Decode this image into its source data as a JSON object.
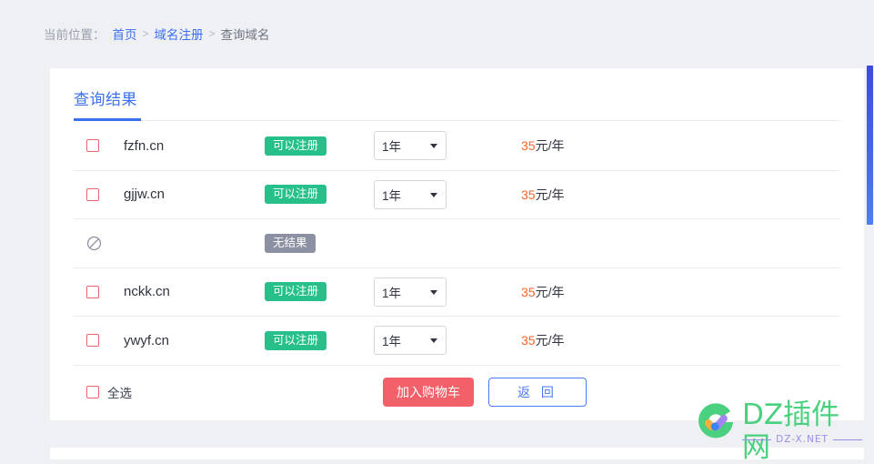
{
  "breadcrumb": {
    "label": "当前位置：",
    "items": [
      {
        "text": "首页",
        "type": "link"
      },
      {
        "text": "域名注册",
        "type": "link"
      },
      {
        "text": "查询域名",
        "type": "current"
      }
    ],
    "separator": ">"
  },
  "card": {
    "tab": {
      "label": "查询结果"
    },
    "rows": [
      {
        "kind": "result",
        "domain": "fzfn.cn",
        "status": "可以注册",
        "period": "1年",
        "price_amount": "35",
        "price_unit": "元/年",
        "checked": false
      },
      {
        "kind": "result",
        "domain": "gjjw.cn",
        "status": "可以注册",
        "period": "1年",
        "price_amount": "35",
        "price_unit": "元/年",
        "checked": false
      },
      {
        "kind": "empty",
        "domain": "",
        "status": "无结果",
        "period": "",
        "price_amount": "",
        "price_unit": "",
        "checked": false
      },
      {
        "kind": "result",
        "domain": "nckk.cn",
        "status": "可以注册",
        "period": "1年",
        "price_amount": "35",
        "price_unit": "元/年",
        "checked": false
      },
      {
        "kind": "result",
        "domain": "ywyf.cn",
        "status": "可以注册",
        "period": "1年",
        "price_amount": "35",
        "price_unit": "元/年",
        "checked": false
      }
    ],
    "footer": {
      "select_all_label": "全选",
      "cart_button": "加入购物车",
      "back_button": "返 回"
    }
  },
  "watermark": {
    "title": "DZ插件网",
    "subtitle": "DZ-X.NET"
  },
  "colors": {
    "accent_blue": "#3b6ef0",
    "status_green": "#27c08a",
    "status_gray": "#8b90a2",
    "price_orange": "#f4662d",
    "cart_red": "#f2606a",
    "checkbox_border": "#e8646e",
    "page_bg": "#eef0f4",
    "watermark_green": "#4ad07e",
    "watermark_purple": "#9b8ce8"
  }
}
